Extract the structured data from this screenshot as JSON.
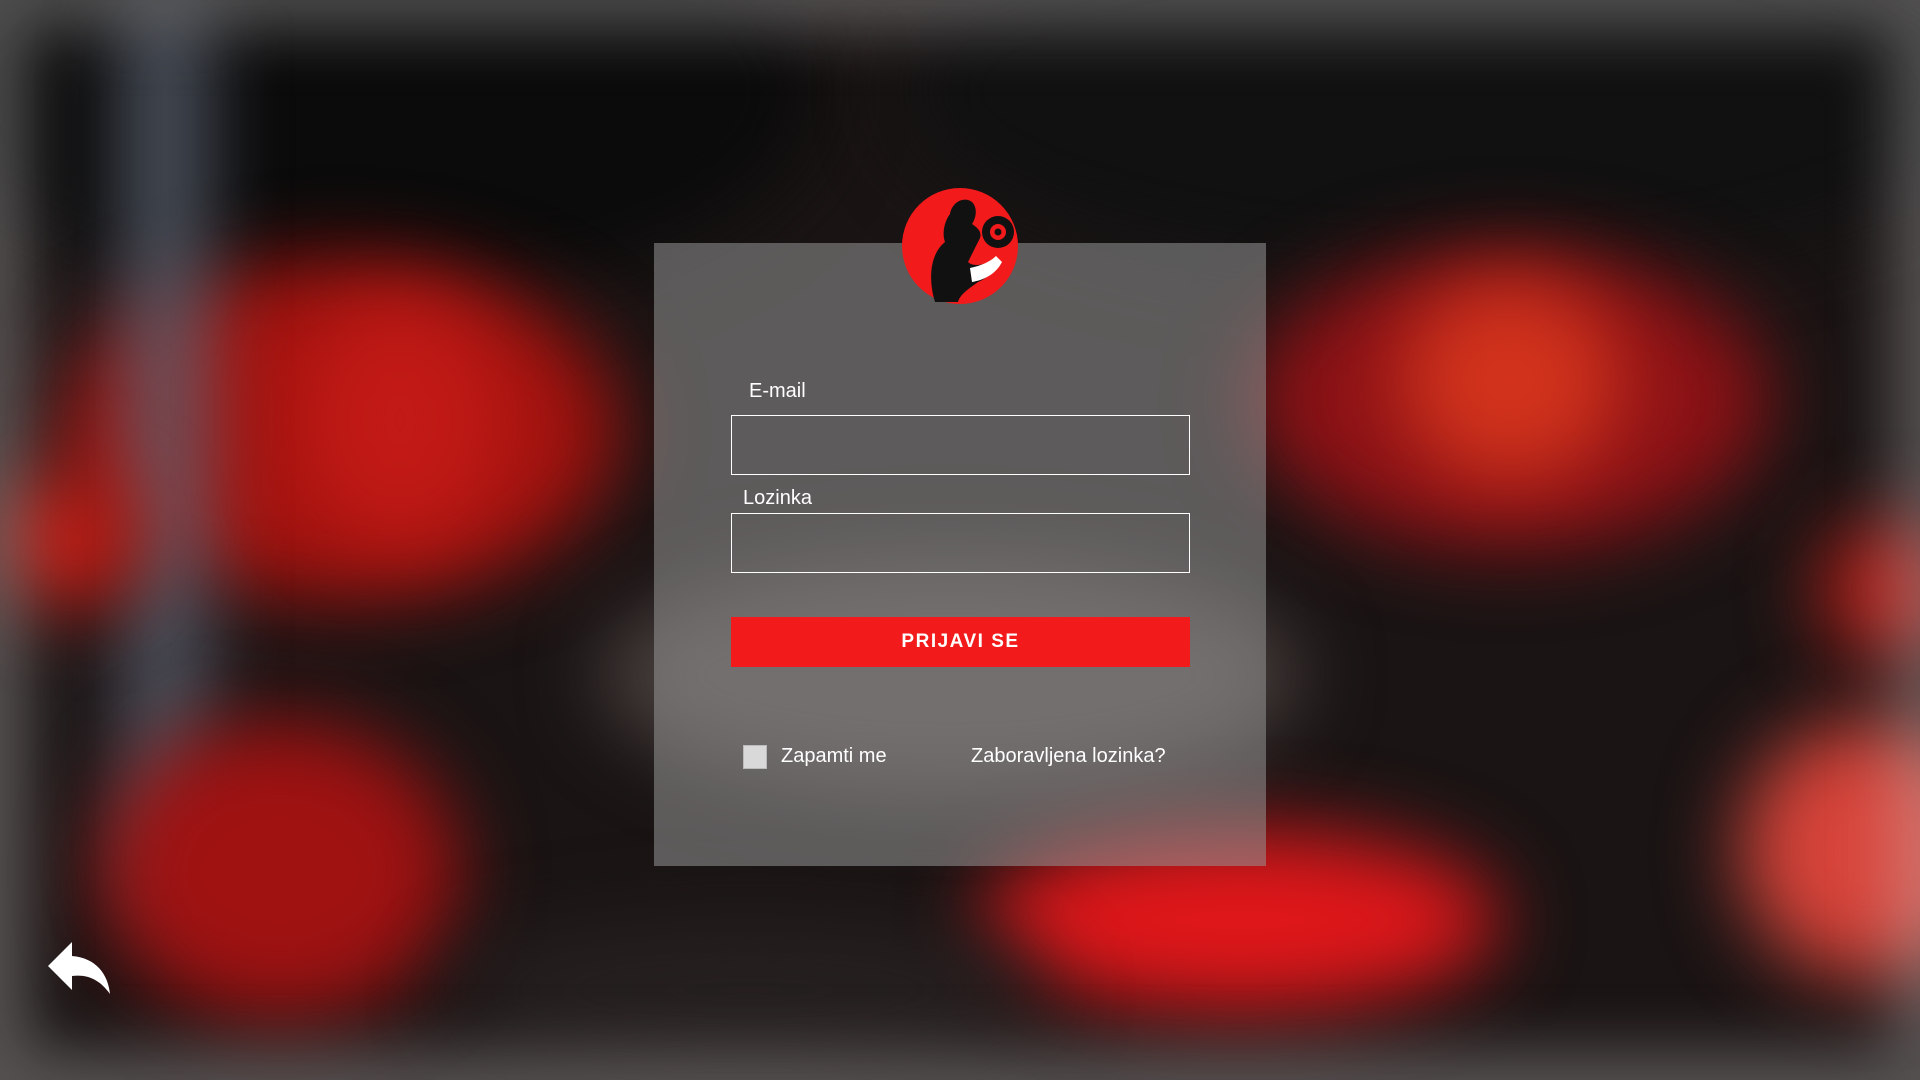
{
  "brand": {
    "logo_icon": "bodybuilder-dumbbell-logo",
    "accent_color": "#f21a1a"
  },
  "form": {
    "email_label": "E-mail",
    "email_value": "",
    "password_label": "Lozinka",
    "password_value": "",
    "submit_label": "PRIJAVI SE",
    "remember_label": "Zapamti me",
    "remember_checked": false,
    "forgot_label": "Zaboravljena lozinka?"
  },
  "navigation": {
    "back_icon": "back-arrow-icon"
  }
}
